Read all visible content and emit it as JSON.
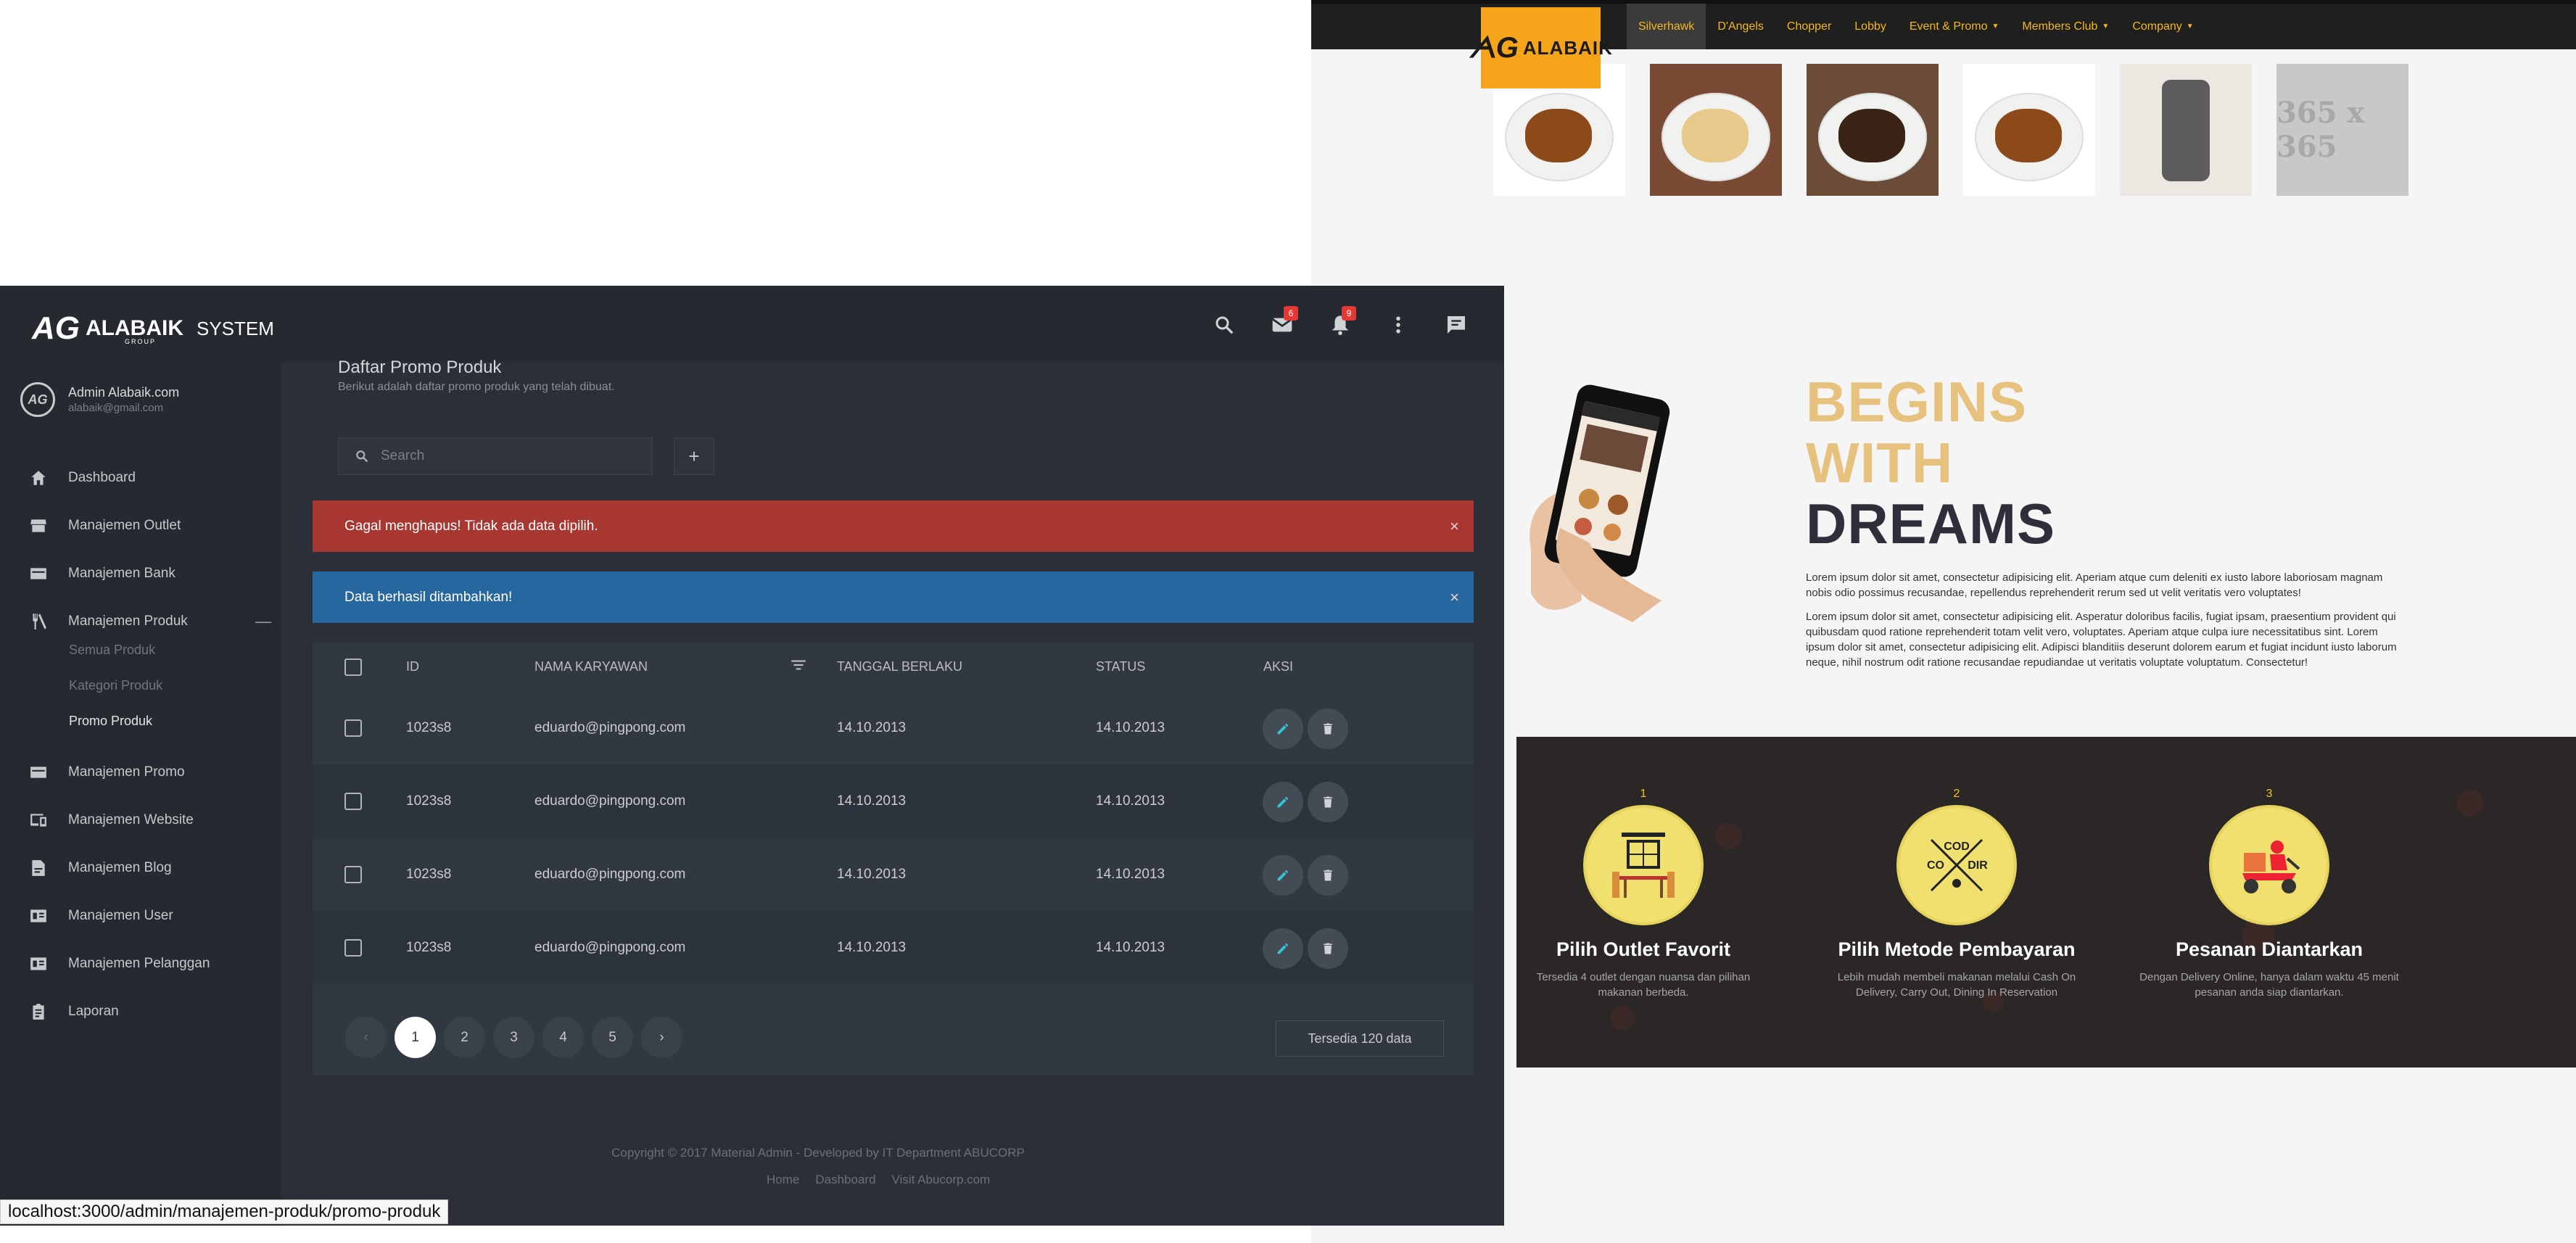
{
  "site": {
    "logo_text": "ALABAIK",
    "nav": [
      {
        "label": "Silverhawk",
        "caret": false
      },
      {
        "label": "D'Angels",
        "caret": false
      },
      {
        "label": "Chopper",
        "caret": false
      },
      {
        "label": "Lobby",
        "caret": false
      },
      {
        "label": "Event & Promo",
        "caret": true
      },
      {
        "label": "Members Club",
        "caret": true
      },
      {
        "label": "Company",
        "caret": true
      }
    ],
    "placeholder_text": "365 x 365",
    "headline": [
      "BEGINS",
      "WITH",
      "DREAMS"
    ],
    "lorem1": "Lorem ipsum dolor sit amet, consectetur adipisicing elit. Aperiam atque cum deleniti ex iusto labore laboriosam magnam nobis odio possimus recusandae, repellendus reprehenderit rerum sed ut velit veritatis vero voluptates!",
    "lorem2": "Lorem ipsum dolor sit amet, consectetur adipisicing elit. Asperatur doloribus facilis, fugiat ipsam, praesentium provident qui quibusdam quod ratione reprehenderit totam velit vero, voluptates. Aperiam atque culpa iure necessitatibus sint. Lorem ipsum dolor sit amet, consectetur adipisicing elit. Adipisci blanditiis deserunt dolorem earum et fugiat incidunt iusto laborum neque, nihil nostrum odit ratione recusandae repudiandae ut veritatis voluptate voluptatum. Consectetur!",
    "steps": [
      {
        "num": "1",
        "title": "Pilih Outlet Favorit",
        "desc": "Tersedia 4 outlet dengan nuansa dan pilihan makanan berbeda."
      },
      {
        "num": "2",
        "title": "Pilih Metode Pembayaran",
        "desc": "Lebih mudah membeli makanan melalui Cash On Delivery, Carry Out, Dining In Reservation"
      },
      {
        "num": "3",
        "title": "Pesanan Diantarkan",
        "desc": "Dengan Delivery Online, hanya dalam waktu 45 menit pesanan anda siap diantarkan."
      }
    ],
    "cod_label": [
      "COD",
      "CO",
      "DIR"
    ]
  },
  "admin": {
    "brand": {
      "mark": "AG",
      "name": "ALABAIK",
      "system": "SYSTEM",
      "group": "GROUP"
    },
    "badges": {
      "mail": "6",
      "notif": "9"
    },
    "user": {
      "name": "Admin Alabaik.com",
      "email": "alabaik@gmail.com"
    },
    "menu": {
      "dashboard": "Dashboard",
      "outlet": "Manajemen Outlet",
      "bank": "Manajemen Bank",
      "produk": "Manajemen Produk",
      "semua": "Semua Produk",
      "kategori": "Kategori Produk",
      "promo_produk": "Promo Produk",
      "promo": "Manajemen Promo",
      "website": "Manajemen Website",
      "blog": "Manajemen Blog",
      "user": "Manajemen User",
      "pelanggan": "Manajemen Pelanggan",
      "laporan": "Laporan"
    },
    "page_title": "Daftar Promo Produk",
    "page_subtitle": "Berikut adalah daftar promo produk yang telah dibuat.",
    "search_placeholder": "Search",
    "add_label": "+",
    "alert_error": "Gagal menghapus! Tidak ada data dipilih.",
    "alert_success": "Data berhasil ditambahkan!",
    "close_glyph": "×",
    "columns": {
      "id": "ID",
      "nama": "NAMA KARYAWAN",
      "tanggal": "TANGGAL BERLAKU",
      "status": "STATUS",
      "aksi": "AKSI"
    },
    "rows": [
      {
        "id": "1023s8",
        "nama": "eduardo@pingpong.com",
        "tanggal": "14.10.2013",
        "status": "14.10.2013"
      },
      {
        "id": "1023s8",
        "nama": "eduardo@pingpong.com",
        "tanggal": "14.10.2013",
        "status": "14.10.2013"
      },
      {
        "id": "1023s8",
        "nama": "eduardo@pingpong.com",
        "tanggal": "14.10.2013",
        "status": "14.10.2013"
      },
      {
        "id": "1023s8",
        "nama": "eduardo@pingpong.com",
        "tanggal": "14.10.2013",
        "status": "14.10.2013"
      }
    ],
    "pages": [
      "1",
      "2",
      "3",
      "4",
      "5"
    ],
    "prev": "‹",
    "next": "›",
    "available": "Tersedia 120 data",
    "copyright": "Copyright © 2017 Material Admin - Developed by IT Department ABUCORP",
    "footer_links": [
      "Home",
      "Dashboard",
      "Visit Abucorp.com"
    ]
  },
  "status_url": "localhost:3000/admin/manajemen-produk/promo-produk",
  "colors": {
    "accent_gold": "#f5b81c",
    "alert_red": "#a83731",
    "alert_blue": "#27679f",
    "edit_icon": "#33c3d6"
  }
}
